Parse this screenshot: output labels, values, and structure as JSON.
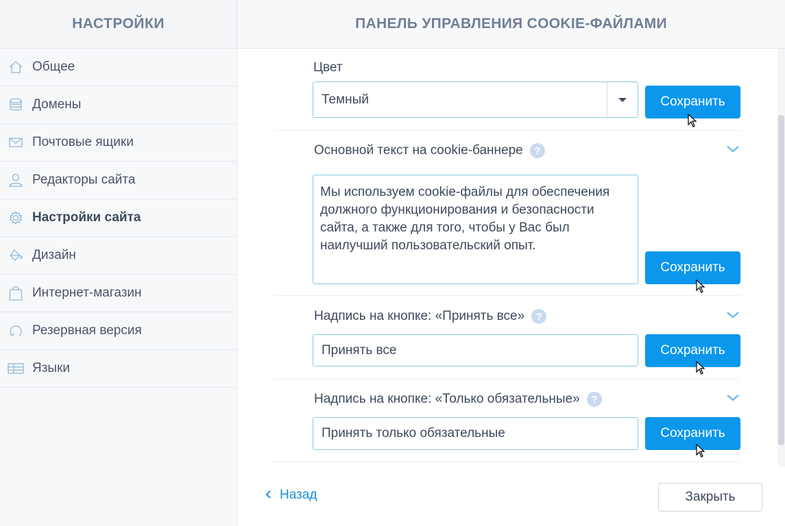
{
  "sidebar": {
    "title": "НАСТРОЙКИ",
    "items": [
      {
        "label": "Общее",
        "icon": "home-icon"
      },
      {
        "label": "Домены",
        "icon": "database-icon"
      },
      {
        "label": "Почтовые ящики",
        "icon": "mail-icon"
      },
      {
        "label": "Редакторы сайта",
        "icon": "user-icon"
      },
      {
        "label": "Настройки сайта",
        "icon": "gear-icon",
        "active": true
      },
      {
        "label": "Дизайн",
        "icon": "paint-bucket-icon"
      },
      {
        "label": "Интернет-магазин",
        "icon": "shopping-bag-icon"
      },
      {
        "label": "Резервная версия",
        "icon": "restore-icon"
      },
      {
        "label": "Языки",
        "icon": "table-icon"
      }
    ]
  },
  "main": {
    "title": "ПАНЕЛЬ УПРАВЛЕНИЯ COOKIE-ФАЙЛАМИ",
    "color_field": {
      "label": "Цвет",
      "value": "Темный",
      "save_label": "Сохранить"
    },
    "banner_text_field": {
      "label": "Основной текст на cookie-баннере",
      "value": "Мы используем cookie-файлы для обеспечения должного функционирования и безопасности сайта, а также для того, чтобы у Вас был наилучший пользовательский опыт.",
      "save_label": "Сохранить"
    },
    "accept_all_field": {
      "label": "Надпись на кнопке: «Принять все»",
      "value": "Принять все",
      "save_label": "Сохранить"
    },
    "required_only_field": {
      "label": "Надпись на кнопке: «Только обязательные»",
      "value": "Принять только обязательные",
      "save_label": "Сохранить"
    }
  },
  "footer": {
    "back_label": "Назад",
    "close_label": "Закрыть"
  },
  "colors": {
    "accent": "#0a97ec",
    "link": "#1a8fdc",
    "input_border": "#8cc7e3",
    "icon": "#8fb8d8"
  }
}
